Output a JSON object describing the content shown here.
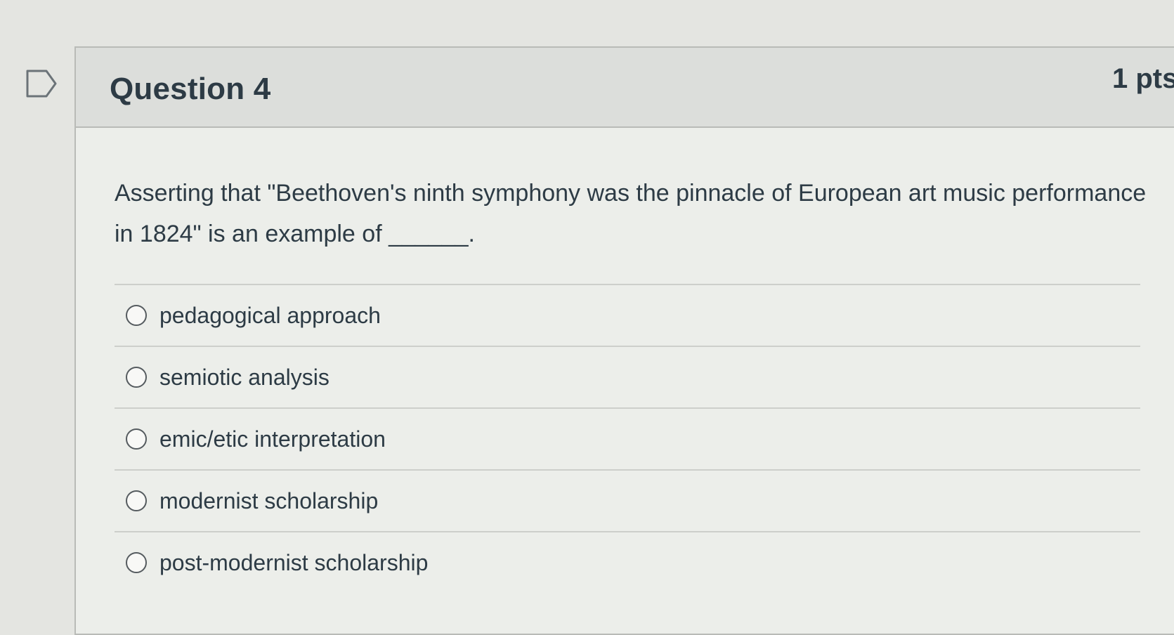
{
  "question": {
    "title": "Question 4",
    "points": "1 pts",
    "prompt": "Asserting that \"Beethoven's ninth symphony was the pinnacle of European art music performance in 1824\" is an example of ______.",
    "answers": [
      {
        "label": "pedagogical approach"
      },
      {
        "label": "semiotic analysis"
      },
      {
        "label": "emic/etic interpretation"
      },
      {
        "label": "modernist scholarship"
      },
      {
        "label": "post-modernist scholarship"
      }
    ],
    "selected": null
  },
  "icons": {
    "bookmark": "bookmark-flag-icon",
    "radio": "radio-unchecked-icon"
  },
  "colors": {
    "text": "#2d3b45",
    "header_bg": "#dcdedb",
    "card_bg": "#eceeea",
    "border": "#b9bbb7"
  }
}
